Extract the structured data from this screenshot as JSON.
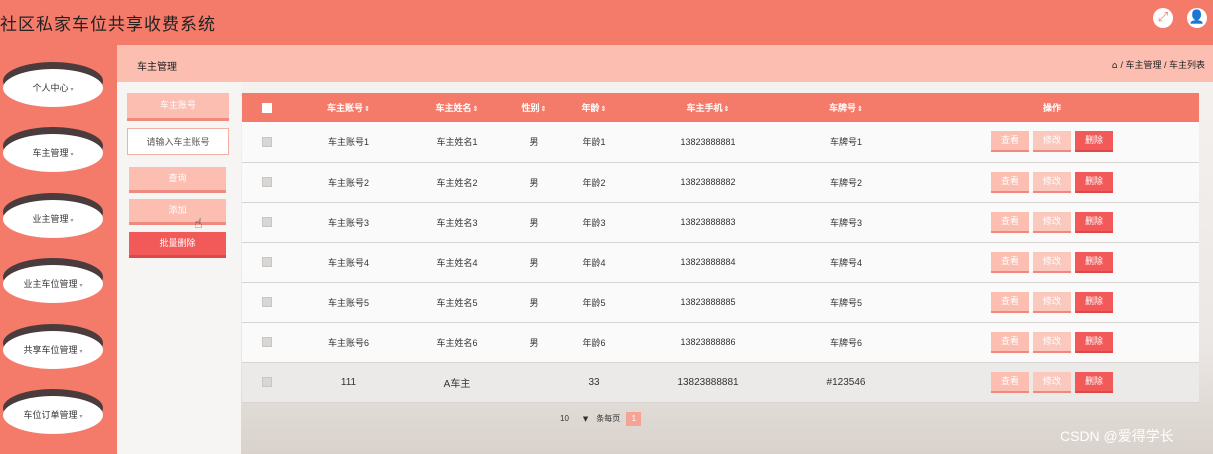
{
  "app": {
    "title": "社区私家车位共享收费系统"
  },
  "topbar": {
    "icons": [
      {
        "name": "expand-icon",
        "glyph": "⤢"
      },
      {
        "name": "user-icon",
        "glyph": "👤"
      }
    ]
  },
  "sidebar": {
    "items": [
      {
        "label": "个人中心"
      },
      {
        "label": "车主管理"
      },
      {
        "label": "业主管理"
      },
      {
        "label": "业主车位管理"
      },
      {
        "label": "共享车位管理"
      },
      {
        "label": "车位订单管理"
      }
    ],
    "caret": "▾"
  },
  "header": {
    "title": "车主管理",
    "breadcrumb": "/ 车主管理 / 车主列表",
    "home_glyph": "⌂"
  },
  "filter": {
    "label": "车主账号",
    "placeholder": "请输入车主账号",
    "query_label": "查询",
    "add_label": "添加",
    "bulk_delete_label": "批量删除"
  },
  "table": {
    "sort_glyph": "⇕",
    "headers": [
      "车主账号",
      "车主姓名",
      "性别",
      "年龄",
      "车主手机",
      "车牌号",
      "操作"
    ],
    "rows": [
      {
        "account": "车主账号1",
        "name": "车主姓名1",
        "gender": "男",
        "age": "年龄1",
        "phone": "13823888881",
        "plate": "车牌号1"
      },
      {
        "account": "车主账号2",
        "name": "车主姓名2",
        "gender": "男",
        "age": "年龄2",
        "phone": "13823888882",
        "plate": "车牌号2"
      },
      {
        "account": "车主账号3",
        "name": "车主姓名3",
        "gender": "男",
        "age": "年龄3",
        "phone": "13823888883",
        "plate": "车牌号3"
      },
      {
        "account": "车主账号4",
        "name": "车主姓名4",
        "gender": "男",
        "age": "年龄4",
        "phone": "13823888884",
        "plate": "车牌号4"
      },
      {
        "account": "车主账号5",
        "name": "车主姓名5",
        "gender": "男",
        "age": "年龄5",
        "phone": "13823888885",
        "plate": "车牌号5"
      },
      {
        "account": "车主账号6",
        "name": "车主姓名6",
        "gender": "男",
        "age": "年龄6",
        "phone": "13823888886",
        "plate": "车牌号6"
      },
      {
        "account": "111",
        "name": "A车主",
        "gender": "",
        "age": "33",
        "phone": "13823888881",
        "plate": "#123546"
      }
    ],
    "actions": {
      "view": "查看",
      "edit": "修改",
      "delete": "删除"
    }
  },
  "pagination": {
    "page_size": "10",
    "per_page_label": "条每页",
    "current_page": "1"
  },
  "watermark": "CSDN @爱得学长",
  "colors": {
    "primary": "#f47a6a",
    "light": "#fbbeb1",
    "danger": "#f25a5a"
  }
}
